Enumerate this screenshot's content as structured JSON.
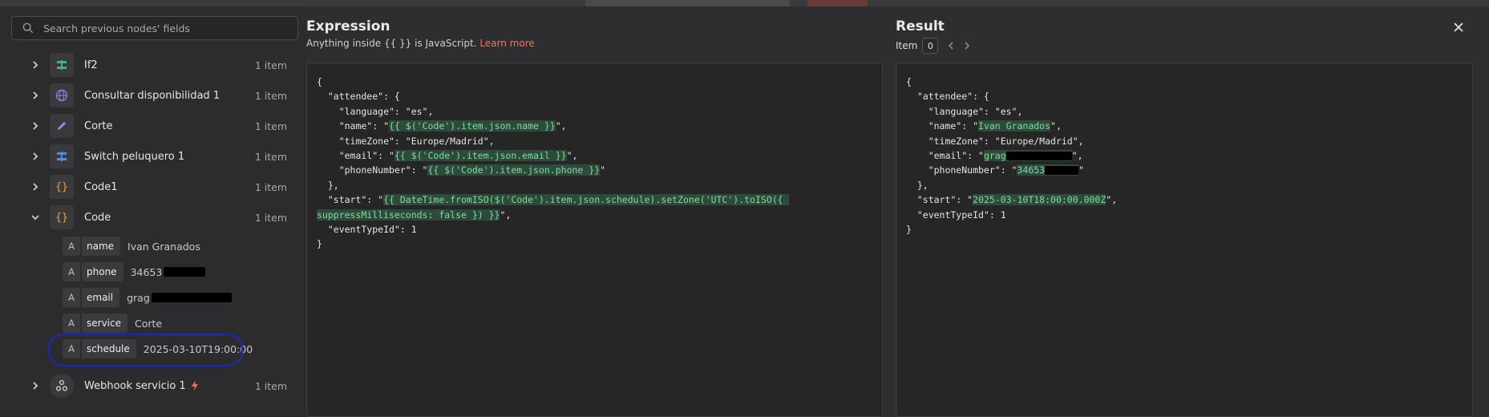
{
  "search": {
    "placeholder": "Search previous nodes' fields"
  },
  "nodes": [
    {
      "label": "If2",
      "count": "1 item"
    },
    {
      "label": "Consultar disponibilidad 1",
      "count": "1 item"
    },
    {
      "label": "Corte",
      "count": "1 item"
    },
    {
      "label": "Switch peluquero 1",
      "count": "1 item"
    },
    {
      "label": "Code1",
      "count": "1 item"
    },
    {
      "label": "Code",
      "count": "1 item"
    },
    {
      "label": "Webhook servicio 1",
      "count": "1 item"
    }
  ],
  "fields": [
    {
      "type": "A",
      "name": "name",
      "value": "Ivan Granados"
    },
    {
      "type": "A",
      "name": "phone",
      "value": "34653"
    },
    {
      "type": "A",
      "name": "email",
      "value": "grag"
    },
    {
      "type": "A",
      "name": "service",
      "value": "Corte"
    },
    {
      "type": "A",
      "name": "schedule",
      "value": "2025-03-10T19:00:00"
    }
  ],
  "expression": {
    "title": "Expression",
    "hint_prefix": "Anything inside {{ }} is JavaScript.",
    "hint_link": "Learn more",
    "lines": {
      "l1": "{",
      "l2": "  \"attendee\": {",
      "l3": "    \"language\": \"es\",",
      "l4a": "    \"name\": \"",
      "l4b": "{{ $('Code').item.json.name }}",
      "l4c": "\",",
      "l5": "    \"timeZone\": \"Europe/Madrid\",",
      "l6a": "    \"email\": \"",
      "l6b": "{{ $('Code').item.json.email }}",
      "l6c": "\",",
      "l7a": "    \"phoneNumber\": \"",
      "l7b": "{{ $('Code').item.json.phone }}",
      "l7c": "\"",
      "l8": "  },",
      "l9a": "  \"start\": \"",
      "l9b": "{{ DateTime.fromISO($('Code').item.json.schedule).setZone('UTC').toISO({ ",
      "l10a": "suppressMilliseconds: false }) }}",
      "l10b": "\",",
      "l11": "  \"eventTypeId\": 1",
      "l12": "}"
    }
  },
  "result": {
    "title": "Result",
    "item_label": "Item",
    "item_index": "0",
    "lines": {
      "l1": "{",
      "l2": "  \"attendee\": {",
      "l3": "    \"language\": \"es\",",
      "l4a": "    \"name\": \"",
      "l4b": "Ivan Granados",
      "l4c": "\",",
      "l5": "    \"timeZone\": \"Europe/Madrid\",",
      "l6a": "    \"email\": \"",
      "l6b": "grag",
      "l6c": "\",",
      "l7a": "    \"phoneNumber\": \"",
      "l7b": "34653",
      "l7c": "\"",
      "l8": "  },",
      "l9a": "  \"start\": \"",
      "l9b": "2025-03-10T18:00:00.000Z",
      "l9c": "\",",
      "l10": "  \"eventTypeId\": 1",
      "l11": "}"
    }
  }
}
